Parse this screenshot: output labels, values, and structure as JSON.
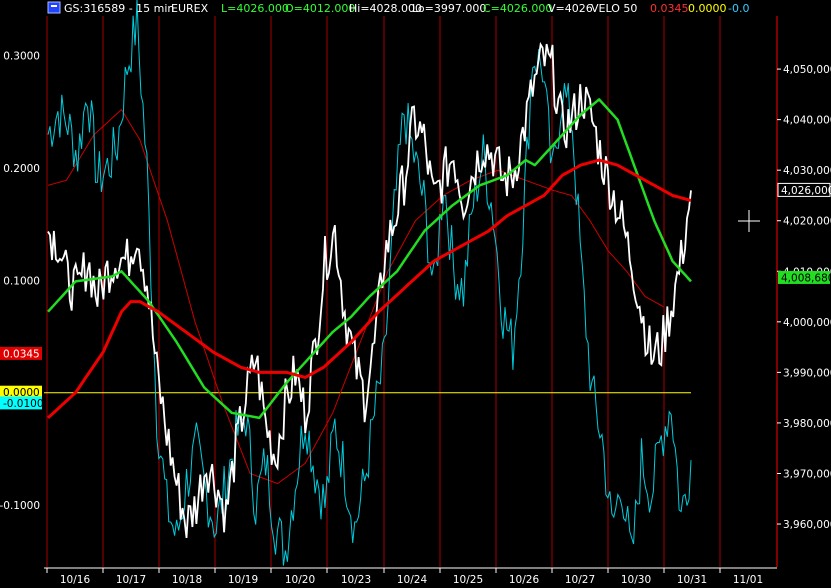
{
  "chart_data": {
    "type": "line",
    "header": {
      "icon": "window-icon",
      "items": [
        {
          "text": "GS:316589 - 15 min",
          "color": "#ffffff"
        },
        {
          "text": "EUREX",
          "color": "#ffffff"
        },
        {
          "text": "L=4026.000",
          "color": "#33ff33"
        },
        {
          "text": "O=4012.000",
          "color": "#33ff33"
        },
        {
          "text": "Hi=4028.000",
          "color": "#ffffff"
        },
        {
          "text": "Lo=3997.000",
          "color": "#ffffff"
        },
        {
          "text": "C=4026.000",
          "color": "#33ff33"
        },
        {
          "text": "V=4026",
          "color": "#ffffff"
        },
        {
          "text": "VELO 50",
          "color": "#ffffff"
        },
        {
          "text": "0.0345",
          "color": "#ff3030"
        },
        {
          "text": "0.0000",
          "color": "#ffff00"
        },
        {
          "text": "-0.0",
          "color": "#33ccff"
        }
      ]
    },
    "x_labels": [
      "10/16",
      "10/17",
      "10/18",
      "10/19",
      "10/20",
      "10/23",
      "10/24",
      "10/25",
      "10/26",
      "10/27",
      "10/30",
      "10/31",
      "11/01"
    ],
    "left_axis": {
      "range": [
        -0.155,
        0.335
      ],
      "ticks": [
        0.3,
        0.2,
        0.1,
        0.0,
        -0.1
      ],
      "tick_labels": [
        "0.3000",
        "0.2000",
        "0.1000",
        "",
        "-0.1000"
      ]
    },
    "right_axis": {
      "range": [
        3951.5,
        4060.5
      ],
      "ticks": [
        4050,
        4040,
        4030,
        4020,
        4010,
        4000,
        3990,
        3980,
        3970,
        3960
      ],
      "tick_labels": [
        "4,050,000",
        "4,040,000",
        "4,030,000",
        "4,020,000",
        "4,010,000",
        "4,000,000",
        "3,990,000",
        "3,980,000",
        "3,970,000",
        "3,960,000"
      ]
    },
    "tags": [
      {
        "label": "0.0345",
        "axis": "left",
        "value": 0.0345,
        "bg": "#e00000",
        "fg": "#ffffff"
      },
      {
        "label": "0.0000",
        "axis": "left",
        "value": 0.0,
        "bg": "#ffff00",
        "fg": "#000000"
      },
      {
        "label": "-0.0100",
        "axis": "left",
        "value": -0.0095,
        "bg": "#00ffff",
        "fg": "#000000"
      },
      {
        "label": "4,026,000",
        "axis": "right",
        "value": 4026.0,
        "bg": "#000000",
        "fg": "#ffffff",
        "border": "#ffffff"
      },
      {
        "label": "4,008,680",
        "axis": "right",
        "value": 4008.68,
        "bg": "#22dd22",
        "fg": "#000000"
      }
    ],
    "zero_line": {
      "axis": "left",
      "value": 0.0,
      "color": "#ffff00"
    },
    "colors": {
      "price": "#ffffff",
      "velo": "#00ccdd",
      "ma_fast": "#22dd22",
      "ma_slow": "#ee0000",
      "ma_thin": "#cc0000",
      "right_axis": "#ff0000"
    },
    "series": [
      {
        "key": "velo",
        "axis": "left",
        "values": [
          [
            0,
            0.23
          ],
          [
            1,
            0.25
          ],
          [
            2,
            0.24
          ],
          [
            3,
            0.21
          ],
          [
            4,
            0.27
          ],
          [
            5,
            0.19
          ],
          [
            6,
            0.2
          ],
          [
            7,
            0.22
          ],
          [
            8,
            0.29
          ],
          [
            9,
            0.33
          ],
          [
            10,
            0.2
          ],
          [
            11,
            -0.02
          ],
          [
            12,
            -0.1
          ],
          [
            13,
            -0.13
          ],
          [
            14,
            -0.08
          ],
          [
            15,
            -0.05
          ],
          [
            16,
            -0.09
          ],
          [
            17,
            -0.12
          ],
          [
            18,
            -0.08
          ],
          [
            19,
            -0.04
          ],
          [
            20,
            -0.02
          ],
          [
            21,
            -0.1
          ],
          [
            22,
            -0.06
          ],
          [
            23,
            -0.12
          ],
          [
            24,
            -0.14
          ],
          [
            25,
            -0.08
          ],
          [
            26,
            -0.02
          ],
          [
            27,
            -0.07
          ],
          [
            28,
            -0.1
          ],
          [
            29,
            -0.03
          ],
          [
            30,
            -0.07
          ],
          [
            31,
            -0.12
          ],
          [
            32,
            -0.08
          ],
          [
            33,
            -0.02
          ],
          [
            34,
            0.03
          ],
          [
            35,
            0.16
          ],
          [
            36,
            0.25
          ],
          [
            37,
            0.21
          ],
          [
            38,
            0.17
          ],
          [
            39,
            0.09
          ],
          [
            40,
            0.19
          ],
          [
            41,
            0.11
          ],
          [
            42,
            0.09
          ],
          [
            43,
            0.17
          ],
          [
            44,
            0.21
          ],
          [
            45,
            0.16
          ],
          [
            46,
            0.07
          ],
          [
            47,
            0.04
          ],
          [
            48,
            0.15
          ],
          [
            49,
            0.3
          ],
          [
            50,
            0.29
          ],
          [
            51,
            0.19
          ],
          [
            52,
            0.27
          ],
          [
            53,
            0.24
          ],
          [
            54,
            0.1
          ],
          [
            55,
            0.0
          ],
          [
            56,
            -0.04
          ],
          [
            57,
            -0.12
          ],
          [
            58,
            -0.08
          ],
          [
            59,
            -0.15
          ],
          [
            60,
            -0.06
          ],
          [
            61,
            -0.09
          ],
          [
            62,
            -0.04
          ],
          [
            63,
            -0.01
          ],
          [
            64,
            -0.11
          ],
          [
            65,
            -0.06
          ]
        ]
      },
      {
        "key": "price",
        "axis": "right",
        "values": [
          [
            0,
            4018
          ],
          [
            1,
            4016
          ],
          [
            2,
            4008
          ],
          [
            3,
            4006
          ],
          [
            4,
            4012
          ],
          [
            5,
            4005
          ],
          [
            6,
            4010
          ],
          [
            7,
            4013
          ],
          [
            8,
            4012
          ],
          [
            9,
            4018
          ],
          [
            10,
            4008
          ],
          [
            11,
            3990
          ],
          [
            12,
            3978
          ],
          [
            13,
            3968
          ],
          [
            14,
            3960
          ],
          [
            15,
            3964
          ],
          [
            16,
            3972
          ],
          [
            17,
            3968
          ],
          [
            18,
            3962
          ],
          [
            19,
            3975
          ],
          [
            20,
            3985
          ],
          [
            21,
            3993
          ],
          [
            22,
            3980
          ],
          [
            23,
            3973
          ],
          [
            24,
            3984
          ],
          [
            25,
            3990
          ],
          [
            26,
            3982
          ],
          [
            27,
            3995
          ],
          [
            28,
            4012
          ],
          [
            29,
            4018
          ],
          [
            30,
            4002
          ],
          [
            31,
            3992
          ],
          [
            32,
            3985
          ],
          [
            33,
            3995
          ],
          [
            34,
            4013
          ],
          [
            35,
            4020
          ],
          [
            36,
            4028
          ],
          [
            37,
            4040
          ],
          [
            38,
            4036
          ],
          [
            39,
            4024
          ],
          [
            40,
            4029
          ],
          [
            41,
            4033
          ],
          [
            42,
            4024
          ],
          [
            43,
            4030
          ],
          [
            44,
            4035
          ],
          [
            45,
            4033
          ],
          [
            46,
            4028
          ],
          [
            47,
            4029
          ],
          [
            48,
            4037
          ],
          [
            49,
            4046
          ],
          [
            50,
            4052
          ],
          [
            51,
            4050
          ],
          [
            52,
            4038
          ],
          [
            53,
            4040
          ],
          [
            54,
            4045
          ],
          [
            55,
            4040
          ],
          [
            56,
            4032
          ],
          [
            57,
            4026
          ],
          [
            58,
            4020
          ],
          [
            59,
            4012
          ],
          [
            60,
            4002
          ],
          [
            61,
            3993
          ],
          [
            62,
            3995
          ],
          [
            63,
            4003
          ],
          [
            64,
            4012
          ],
          [
            65,
            4026
          ]
        ]
      },
      {
        "key": "ma_fast",
        "axis": "right",
        "values": [
          [
            0,
            4002
          ],
          [
            3,
            4008
          ],
          [
            7,
            4009
          ],
          [
            8,
            4010
          ],
          [
            9,
            4008
          ],
          [
            11,
            4004
          ],
          [
            14,
            3996
          ],
          [
            17,
            3987
          ],
          [
            20,
            3982
          ],
          [
            23,
            3981
          ],
          [
            26,
            3988
          ],
          [
            29,
            3994
          ],
          [
            31,
            3998
          ],
          [
            33,
            4001
          ],
          [
            35,
            4005
          ],
          [
            38,
            4010
          ],
          [
            41,
            4018
          ],
          [
            44,
            4023
          ],
          [
            47,
            4027
          ],
          [
            50,
            4029
          ],
          [
            52,
            4032
          ],
          [
            53,
            4031
          ],
          [
            55,
            4035
          ],
          [
            58,
            4041
          ],
          [
            60,
            4044
          ],
          [
            62,
            4040
          ],
          [
            64,
            4030
          ],
          [
            66,
            4020
          ],
          [
            68,
            4012
          ],
          [
            70,
            4008
          ]
        ]
      },
      {
        "key": "ma_slow",
        "axis": "right",
        "values": [
          [
            0,
            3981
          ],
          [
            3,
            3986
          ],
          [
            6,
            3994
          ],
          [
            8,
            4002
          ],
          [
            9,
            4004
          ],
          [
            10,
            4004
          ],
          [
            12,
            4002
          ],
          [
            15,
            3998
          ],
          [
            18,
            3994
          ],
          [
            21,
            3991
          ],
          [
            23,
            3990
          ],
          [
            26,
            3990
          ],
          [
            28,
            3989
          ],
          [
            30,
            3991
          ],
          [
            33,
            3996
          ],
          [
            36,
            4002
          ],
          [
            39,
            4007
          ],
          [
            42,
            4012
          ],
          [
            45,
            4015
          ],
          [
            48,
            4018
          ],
          [
            50,
            4021
          ],
          [
            52,
            4023
          ],
          [
            54,
            4025
          ],
          [
            56,
            4029
          ],
          [
            58,
            4031
          ],
          [
            60,
            4032
          ],
          [
            62,
            4031
          ],
          [
            64,
            4029
          ],
          [
            66,
            4027
          ],
          [
            68,
            4025
          ],
          [
            70,
            4024
          ]
        ]
      },
      {
        "key": "ma_thin",
        "axis": "right",
        "values": [
          [
            0,
            4027
          ],
          [
            2,
            4028
          ],
          [
            5,
            4037
          ],
          [
            8,
            4042
          ],
          [
            10,
            4036
          ],
          [
            13,
            4020
          ],
          [
            16,
            4000
          ],
          [
            19,
            3984
          ],
          [
            22,
            3970
          ],
          [
            25,
            3968
          ],
          [
            28,
            3972
          ],
          [
            31,
            3982
          ],
          [
            34,
            3996
          ],
          [
            37,
            4010
          ],
          [
            40,
            4020
          ],
          [
            43,
            4025
          ],
          [
            46,
            4028
          ],
          [
            49,
            4030
          ],
          [
            52,
            4028
          ],
          [
            55,
            4026
          ],
          [
            57,
            4025
          ],
          [
            59,
            4020
          ],
          [
            61,
            4014
          ],
          [
            63,
            4010
          ],
          [
            65,
            4005
          ],
          [
            67,
            4003
          ]
        ]
      }
    ]
  }
}
